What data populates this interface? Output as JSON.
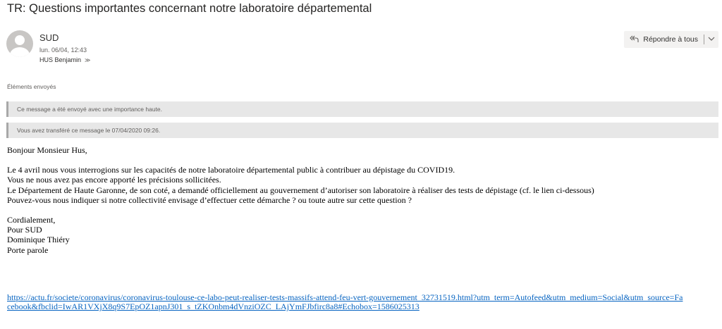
{
  "subject": "TR: Questions importantes concernant notre laboratoire départemental",
  "sender": {
    "name": "SUD",
    "date": "lun. 06/04, 12:43",
    "to": "HUS Benjamin",
    "to_chevron": "≫"
  },
  "actions": {
    "reply_all_label": "Répondre à tous",
    "reply_icon": "reply-all-icon",
    "more_chevron": "⌄"
  },
  "folder": "Éléments envoyés",
  "info_bars": [
    "Ce message a été envoyé avec une importance haute.",
    "Vous avez transféré ce message le 07/04/2020 09:26."
  ],
  "body": {
    "greeting": "Bonjour Monsieur Hus,",
    "paragraph": [
      "Le 4 avril nous vous interrogions sur les capacités de notre laboratoire départemental public à contribuer au dépistage du COVID19.",
      "Vous ne nous avez pas encore apporté les précisions sollicitées.",
      "Le Département de Haute Garonne, de son coté, a demandé officiellement au gouvernement d’autoriser son laboratoire à réaliser des tests de dépistage (cf. le lien ci-dessous)",
      "Pouvez-vous nous indiquer si notre collectivité envisage d’effectuer cette démarche ? ou toute autre sur cette question ?"
    ],
    "signature": [
      "Cordialement,",
      "Pour SUD",
      "Dominique Thiéry",
      "Porte parole"
    ],
    "link": "https://actu.fr/societe/coronavirus/coronavirus-toulouse-ce-labo-peut-realiser-tests-massifs-attend-feu-vert-gouvernement_32731519.html?utm_term=Autofeed&utm_medium=Social&utm_source=Facebook&fbclid=IwAR1VXjX8q9S7EpOZ1apnJ301_s_tZKOnbm4dVnziOZC_LAjYmFJbfirc8a8#Echobox=1586025313"
  },
  "colors": {
    "link": "#0563c1",
    "info_bar": "#e7e7e7",
    "avatar": "#c8c6c4"
  }
}
